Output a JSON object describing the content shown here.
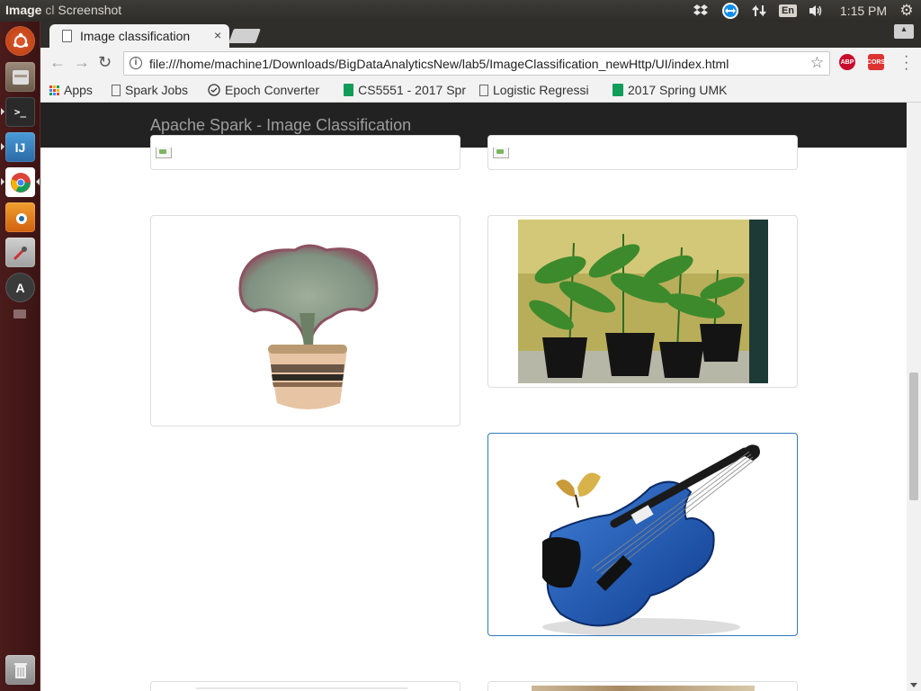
{
  "system_bar": {
    "window_title_bold": "Image",
    "window_title_rest": "cl",
    "window_title_app": "Screenshot",
    "keyboard": "En",
    "clock": "1:15 PM",
    "gear_glyph": "⚙",
    "volume_glyph": "🔊"
  },
  "browser": {
    "tab_title": "Image classification",
    "tab_close": "×",
    "url": "file:///home/machine1/Downloads/BigDataAnalyticsNew/lab5/ImageClassification_newHttp/UI/index.html",
    "back_glyph": "←",
    "forward_glyph": "→",
    "reload_glyph": "↻",
    "star_glyph": "☆",
    "extensions": [
      {
        "name": "abp-icon",
        "label": "ABP",
        "color": "#c70d2c"
      },
      {
        "name": "cors-icon",
        "label": "CORS",
        "color": "#d33"
      }
    ],
    "bookmarks": [
      {
        "label": "Apps",
        "icon": "apps-grid-icon"
      },
      {
        "label": "Spark Jobs",
        "icon": "page-icon"
      },
      {
        "label": "Epoch Converter",
        "icon": "clock-icon"
      },
      {
        "label": "CS5551 - 2017 Spr",
        "icon": "sheets-icon"
      },
      {
        "label": "Logistic Regressi",
        "icon": "page-icon"
      },
      {
        "label": "2017 Spring UMK",
        "icon": "sheets-icon"
      }
    ]
  },
  "page": {
    "navbar_brand": "Apache Spark - Image Classification",
    "images": [
      {
        "name": "broken-image-left",
        "kind": "broken"
      },
      {
        "name": "broken-image-right",
        "kind": "broken"
      },
      {
        "name": "potted-cactus-image",
        "kind": "cactus"
      },
      {
        "name": "cannabis-plants-image",
        "kind": "plants"
      },
      {
        "name": "blue-violin-image",
        "kind": "violin",
        "selected": true
      },
      {
        "name": "partial-image-left",
        "kind": "partial"
      },
      {
        "name": "partial-image-right",
        "kind": "partial"
      }
    ]
  },
  "colors": {
    "navbar_bg": "#222222",
    "brand_text": "#9d9d9d",
    "active_border": "#337ab7",
    "launcher_bg": "#4b1b1b"
  }
}
